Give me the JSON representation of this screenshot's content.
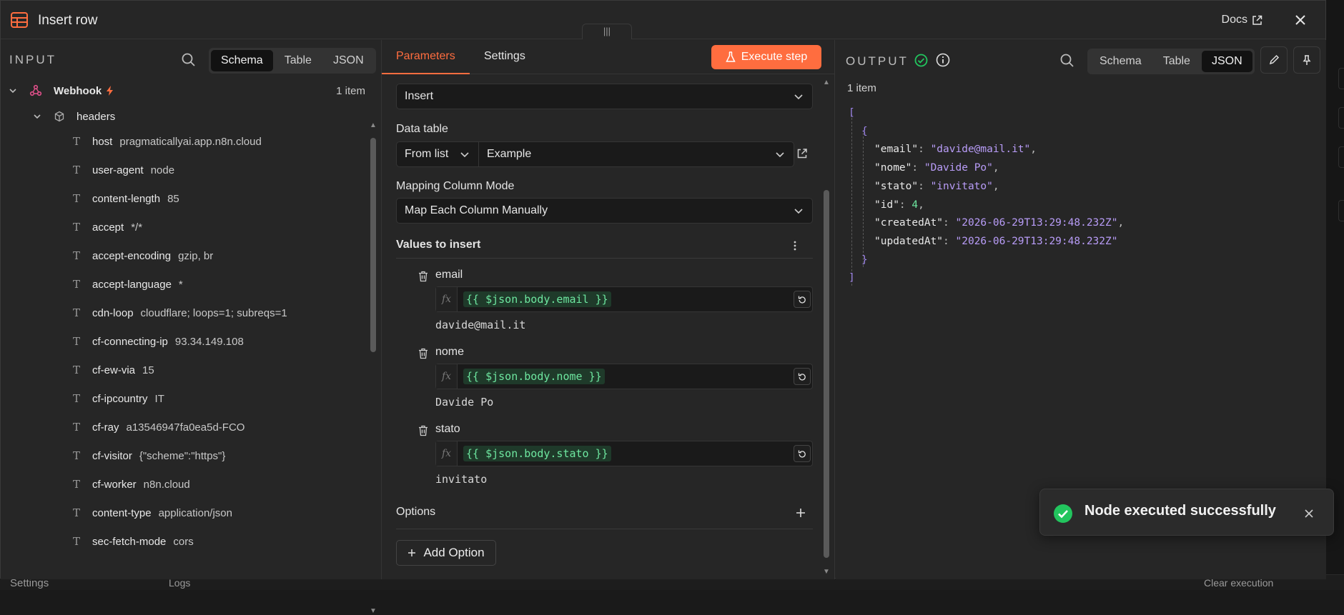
{
  "backdrop": {
    "settings_label": "Settings",
    "logs_label": "Logs",
    "clear_execution_label": "Clear execution"
  },
  "modal": {
    "title": "Insert row",
    "docs_label": "Docs",
    "drag_handle_glyph": "|||"
  },
  "input": {
    "label": "INPUT",
    "view_tabs": [
      "Schema",
      "Table",
      "JSON"
    ],
    "active_view": "Schema",
    "node": {
      "name": "Webhook",
      "count": "1 item"
    },
    "group": "headers",
    "fields": [
      {
        "key": "host",
        "value": "pragmaticallyai.app.n8n.cloud"
      },
      {
        "key": "user-agent",
        "value": "node"
      },
      {
        "key": "content-length",
        "value": "85"
      },
      {
        "key": "accept",
        "value": "*/*"
      },
      {
        "key": "accept-encoding",
        "value": "gzip, br"
      },
      {
        "key": "accept-language",
        "value": "*"
      },
      {
        "key": "cdn-loop",
        "value": "cloudflare; loops=1; subreqs=1"
      },
      {
        "key": "cf-connecting-ip",
        "value": "93.34.149.108"
      },
      {
        "key": "cf-ew-via",
        "value": "15"
      },
      {
        "key": "cf-ipcountry",
        "value": "IT"
      },
      {
        "key": "cf-ray",
        "value": "a13546947fa0ea5d-FCO"
      },
      {
        "key": "cf-visitor",
        "value": "{\"scheme\":\"https\"}"
      },
      {
        "key": "cf-worker",
        "value": "n8n.cloud"
      },
      {
        "key": "content-type",
        "value": "application/json"
      },
      {
        "key": "sec-fetch-mode",
        "value": "cors"
      }
    ]
  },
  "params": {
    "tabs": [
      "Parameters",
      "Settings"
    ],
    "active_tab": "Parameters",
    "execute_label": "Execute step",
    "operation_value": "Insert",
    "data_table_label": "Data table",
    "data_table_source": "From list",
    "data_table_value": "Example",
    "mapping_label": "Mapping Column Mode",
    "mapping_value": "Map Each Column Manually",
    "values_label": "Values to insert",
    "columns": [
      {
        "name": "email",
        "expression": "{{ $json.body.email }}",
        "preview": "davide@mail.it"
      },
      {
        "name": "nome",
        "expression": "{{ $json.body.nome }}",
        "preview": "Davide Po"
      },
      {
        "name": "stato",
        "expression": "{{ $json.body.stato }}",
        "preview": "invitato"
      }
    ],
    "fx_label": "fx",
    "options_label": "Options",
    "add_option_label": "Add Option"
  },
  "output": {
    "label": "OUTPUT",
    "view_tabs": [
      "Schema",
      "Table",
      "JSON"
    ],
    "active_view": "JSON",
    "count": "1 item",
    "json": {
      "open_bracket": "[",
      "open_brace": "{",
      "rows": [
        {
          "key": "\"email\"",
          "value": "\"davide@mail.it\"",
          "type": "string",
          "comma": ","
        },
        {
          "key": "\"nome\"",
          "value": "\"Davide Po\"",
          "type": "string",
          "comma": ","
        },
        {
          "key": "\"stato\"",
          "value": "\"invitato\"",
          "type": "string",
          "comma": ","
        },
        {
          "key": "\"id\"",
          "value": "4",
          "type": "number",
          "comma": ","
        },
        {
          "key": "\"createdAt\"",
          "value": "\"2026-06-29T13:29:48.232Z\"",
          "type": "string",
          "comma": ","
        },
        {
          "key": "\"updatedAt\"",
          "value": "\"2026-06-29T13:29:48.232Z\"",
          "type": "string",
          "comma": ""
        }
      ],
      "close_brace": "}",
      "close_bracket": "]"
    }
  },
  "toast": {
    "message": "Node executed successfully"
  },
  "colors": {
    "accent": "#ff6d3f",
    "success": "#22c55e",
    "json_string": "#b89cf7",
    "json_number": "#6ee7a0"
  }
}
